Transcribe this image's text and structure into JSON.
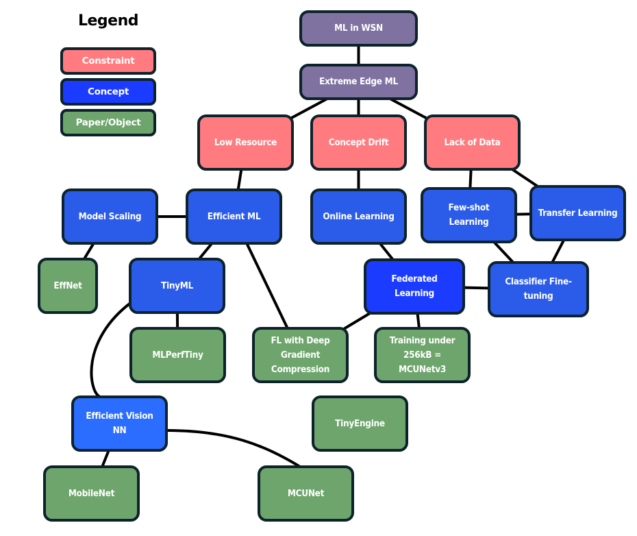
{
  "legend": {
    "title": "Legend",
    "items": [
      {
        "label": "Constraint",
        "color": "#ff7b7f"
      },
      {
        "label": "Concept",
        "color": "#1b3cff"
      },
      {
        "label": "Paper/Object",
        "color": "#6ea56c"
      }
    ]
  },
  "colors": {
    "root": "#7f71a0",
    "constraint": "#ff7b7f",
    "concept": "#2b5ce9",
    "concept_bright": "#1b3cff",
    "concept_light": "#2a6dff",
    "paper": "#6ea56c",
    "border": "#0d222b",
    "edge": "#000000"
  },
  "nodes": {
    "ml_in_wsn": {
      "label": "ML in WSN",
      "category": "root"
    },
    "extreme_edge_ml": {
      "label": "Extreme Edge ML",
      "category": "root"
    },
    "low_resource": {
      "label": "Low Resource",
      "category": "constraint"
    },
    "concept_drift": {
      "label": "Concept Drift",
      "category": "constraint"
    },
    "lack_of_data": {
      "label": "Lack of Data",
      "category": "constraint"
    },
    "model_scaling": {
      "label": "Model Scaling",
      "category": "concept"
    },
    "efficient_ml": {
      "label": "Efficient ML",
      "category": "concept"
    },
    "online_learning": {
      "label": "Online Learning",
      "category": "concept"
    },
    "few_shot_learning": {
      "label": "Few-shot Learning",
      "category": "concept"
    },
    "transfer_learning": {
      "label": "Transfer Learning",
      "category": "concept"
    },
    "effnet": {
      "label": "EffNet",
      "category": "paper"
    },
    "tinyml": {
      "label": "TinyML",
      "category": "concept"
    },
    "federated_learning": {
      "label": "Federated Learning",
      "category": "concept"
    },
    "classifier_fine_tuning": {
      "label": "Classifier Fine-tuning",
      "category": "concept"
    },
    "mlperftiny": {
      "label": "MLPerfTiny",
      "category": "paper"
    },
    "fl_deep_gradient": {
      "label": "FL with Deep Gradient Compression",
      "category": "paper"
    },
    "training_256kb": {
      "label": "Training under 256kB = MCUNetv3",
      "category": "paper"
    },
    "efficient_vision_nn": {
      "label": "Efficient Vision NN",
      "category": "concept"
    },
    "tinyengine": {
      "label": "TinyEngine",
      "category": "paper"
    },
    "mobilenet": {
      "label": "MobileNet",
      "category": "paper"
    },
    "mcunet": {
      "label": "MCUNet",
      "category": "paper"
    }
  },
  "edges": [
    [
      "ml_in_wsn",
      "extreme_edge_ml"
    ],
    [
      "extreme_edge_ml",
      "low_resource"
    ],
    [
      "extreme_edge_ml",
      "concept_drift"
    ],
    [
      "extreme_edge_ml",
      "lack_of_data"
    ],
    [
      "low_resource",
      "efficient_ml"
    ],
    [
      "concept_drift",
      "online_learning"
    ],
    [
      "lack_of_data",
      "few_shot_learning"
    ],
    [
      "lack_of_data",
      "transfer_learning"
    ],
    [
      "model_scaling",
      "efficient_ml"
    ],
    [
      "model_scaling",
      "effnet"
    ],
    [
      "efficient_ml",
      "tinyml"
    ],
    [
      "efficient_ml",
      "fl_deep_gradient"
    ],
    [
      "online_learning",
      "federated_learning"
    ],
    [
      "few_shot_learning",
      "transfer_learning"
    ],
    [
      "few_shot_learning",
      "classifier_fine_tuning"
    ],
    [
      "transfer_learning",
      "classifier_fine_tuning"
    ],
    [
      "federated_learning",
      "classifier_fine_tuning"
    ],
    [
      "federated_learning",
      "fl_deep_gradient"
    ],
    [
      "federated_learning",
      "training_256kb"
    ],
    [
      "tinyml",
      "mlperftiny"
    ],
    [
      "tinyml",
      "efficient_vision_nn"
    ],
    [
      "efficient_vision_nn",
      "mobilenet"
    ],
    [
      "efficient_vision_nn",
      "mcunet"
    ]
  ]
}
